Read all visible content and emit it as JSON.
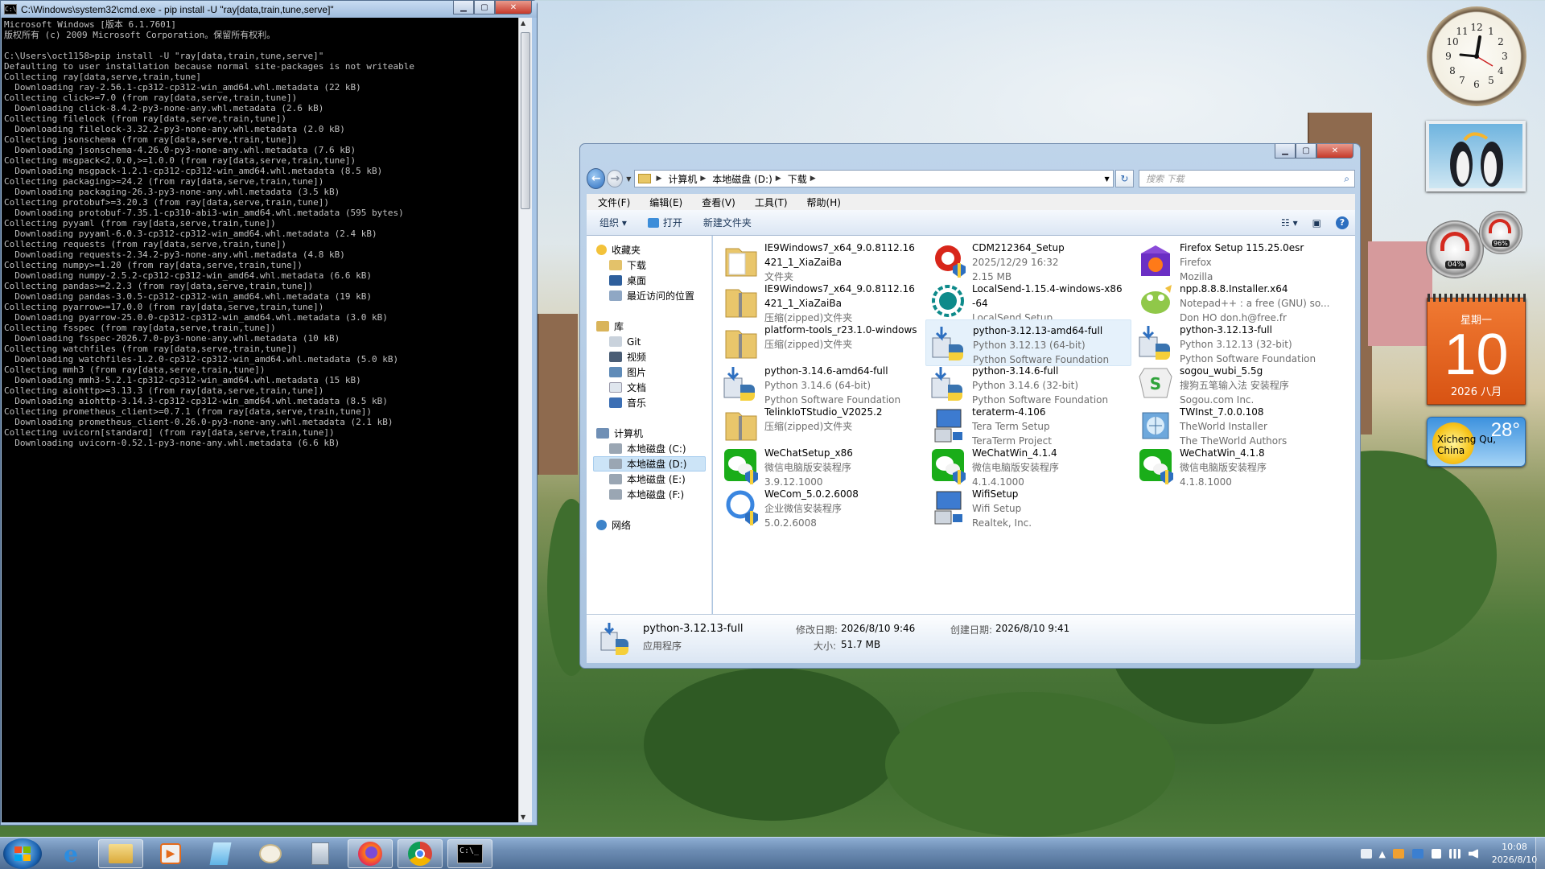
{
  "cmd": {
    "title": "C:\\Windows\\system32\\cmd.exe - pip  install -U \"ray[data,train,tune,serve]\"",
    "lines": [
      "Microsoft Windows [版本 6.1.7601]",
      "版权所有 (c) 2009 Microsoft Corporation。保留所有权利。",
      "",
      "C:\\Users\\oct1158>pip install -U \"ray[data,train,tune,serve]\"",
      "Defaulting to user installation because normal site-packages is not writeable",
      "Collecting ray[data,serve,train,tune]",
      "  Downloading ray-2.56.1-cp312-cp312-win_amd64.whl.metadata (22 kB)",
      "Collecting click>=7.0 (from ray[data,serve,train,tune])",
      "  Downloading click-8.4.2-py3-none-any.whl.metadata (2.6 kB)",
      "Collecting filelock (from ray[data,serve,train,tune])",
      "  Downloading filelock-3.32.2-py3-none-any.whl.metadata (2.0 kB)",
      "Collecting jsonschema (from ray[data,serve,train,tune])",
      "  Downloading jsonschema-4.26.0-py3-none-any.whl.metadata (7.6 kB)",
      "Collecting msgpack<2.0.0,>=1.0.0 (from ray[data,serve,train,tune])",
      "  Downloading msgpack-1.2.1-cp312-cp312-win_amd64.whl.metadata (8.5 kB)",
      "Collecting packaging>=24.2 (from ray[data,serve,train,tune])",
      "  Downloading packaging-26.3-py3-none-any.whl.metadata (3.5 kB)",
      "Collecting protobuf>=3.20.3 (from ray[data,serve,train,tune])",
      "  Downloading protobuf-7.35.1-cp310-abi3-win_amd64.whl.metadata (595 bytes)",
      "Collecting pyyaml (from ray[data,serve,train,tune])",
      "  Downloading pyyaml-6.0.3-cp312-cp312-win_amd64.whl.metadata (2.4 kB)",
      "Collecting requests (from ray[data,serve,train,tune])",
      "  Downloading requests-2.34.2-py3-none-any.whl.metadata (4.8 kB)",
      "Collecting numpy>=1.20 (from ray[data,serve,train,tune])",
      "  Downloading numpy-2.5.2-cp312-cp312-win_amd64.whl.metadata (6.6 kB)",
      "Collecting pandas>=2.2.3 (from ray[data,serve,train,tune])",
      "  Downloading pandas-3.0.5-cp312-cp312-win_amd64.whl.metadata (19 kB)",
      "Collecting pyarrow>=17.0.0 (from ray[data,serve,train,tune])",
      "  Downloading pyarrow-25.0.0-cp312-cp312-win_amd64.whl.metadata (3.0 kB)",
      "Collecting fsspec (from ray[data,serve,train,tune])",
      "  Downloading fsspec-2026.7.0-py3-none-any.whl.metadata (10 kB)",
      "Collecting watchfiles (from ray[data,serve,train,tune])",
      "  Downloading watchfiles-1.2.0-cp312-cp312-win_amd64.whl.metadata (5.0 kB)",
      "Collecting mmh3 (from ray[data,serve,train,tune])",
      "  Downloading mmh3-5.2.1-cp312-cp312-win_amd64.whl.metadata (15 kB)",
      "Collecting aiohttp>=3.13.3 (from ray[data,serve,train,tune])",
      "  Downloading aiohttp-3.14.3-cp312-cp312-win_amd64.whl.metadata (8.5 kB)",
      "Collecting prometheus_client>=0.7.1 (from ray[data,serve,train,tune])",
      "  Downloading prometheus_client-0.26.0-py3-none-any.whl.metadata (2.1 kB)",
      "Collecting uvicorn[standard] (from ray[data,serve,train,tune])",
      "  Downloading uvicorn-0.52.1-py3-none-any.whl.metadata (6.6 kB)"
    ]
  },
  "explorer": {
    "breadcrumb": [
      "计算机",
      "本地磁盘 (D:)",
      "下载"
    ],
    "search_placeholder": "搜索 下载",
    "menu": [
      "文件(F)",
      "编辑(E)",
      "查看(V)",
      "工具(T)",
      "帮助(H)"
    ],
    "toolbar": {
      "organize": "组织 ▾",
      "open": "打开",
      "new_folder": "新建文件夹"
    },
    "nav": {
      "favorites": "收藏夹",
      "downloads": "下载",
      "desktop": "桌面",
      "recent": "最近访问的位置",
      "libraries": "库",
      "git": "Git",
      "videos": "视频",
      "pictures": "图片",
      "documents": "文档",
      "music": "音乐",
      "computer": "计算机",
      "drive_c": "本地磁盘 (C:)",
      "drive_d": "本地磁盘 (D:)",
      "drive_e": "本地磁盘 (E:)",
      "drive_f": "本地磁盘 (F:)",
      "network": "网络"
    },
    "files": [
      {
        "name": "IE9Windows7_x64_9.0.8112.16421_1_XiaZaiBa",
        "l2": "文件夹",
        "l3": "",
        "icon": "folder-icon"
      },
      {
        "name": "CDM212364_Setup",
        "l2": "2025/12/29 16:32",
        "l3": "2.15 MB",
        "icon": "setup-icon"
      },
      {
        "name": "Firefox Setup 115.25.0esr",
        "l2": "Firefox",
        "l3": "Mozilla",
        "icon": "firefox-setup-icon"
      },
      {
        "name": "IE9Windows7_x64_9.0.8112.16421_1_XiaZaiBa",
        "l2": "压缩(zipped)文件夹",
        "l3": "",
        "icon": "zip-folder-icon"
      },
      {
        "name": "LocalSend-1.15.4-windows-x86-64",
        "l2": "LocalSend Setup",
        "l3": "",
        "icon": "localsend-icon"
      },
      {
        "name": "npp.8.8.8.Installer.x64",
        "l2": "Notepad++ : a free (GNU) so...",
        "l3": "Don HO don.h@free.fr",
        "icon": "notepadpp-icon"
      },
      {
        "name": "platform-tools_r23.1.0-windows",
        "l2": "压缩(zipped)文件夹",
        "l3": "",
        "icon": "zip-folder-icon"
      },
      {
        "name": "python-3.12.13-amd64-full",
        "l2": "Python 3.12.13 (64-bit)",
        "l3": "Python Software Foundation",
        "icon": "python-installer-icon"
      },
      {
        "name": "python-3.12.13-full",
        "l2": "Python 3.12.13 (32-bit)",
        "l3": "Python Software Foundation",
        "icon": "python-installer-icon"
      },
      {
        "name": "python-3.14.6-amd64-full",
        "l2": "Python 3.14.6 (64-bit)",
        "l3": "Python Software Foundation",
        "icon": "python-installer-icon"
      },
      {
        "name": "python-3.14.6-full",
        "l2": "Python 3.14.6 (32-bit)",
        "l3": "Python Software Foundation",
        "icon": "python-installer-icon"
      },
      {
        "name": "sogou_wubi_5.5g",
        "l2": "搜狗五笔输入法 安装程序",
        "l3": "Sogou.com Inc.",
        "icon": "sogou-icon"
      },
      {
        "name": "TelinkIoTStudio_V2025.2",
        "l2": "压缩(zipped)文件夹",
        "l3": "",
        "icon": "zip-folder-icon"
      },
      {
        "name": "teraterm-4.106",
        "l2": "Tera Term Setup",
        "l3": "TeraTerm Project",
        "icon": "setup-monitor-icon"
      },
      {
        "name": "TWInst_7.0.0.108",
        "l2": "TheWorld Installer",
        "l3": "The TheWorld Authors",
        "icon": "theworld-icon"
      },
      {
        "name": "WeChatSetup_x86",
        "l2": "微信电脑版安装程序",
        "l3": "3.9.12.1000",
        "icon": "wechat-icon"
      },
      {
        "name": "WeChatWin_4.1.4",
        "l2": "微信电脑版安装程序",
        "l3": "4.1.4.1000",
        "icon": "wechat-icon"
      },
      {
        "name": "WeChatWin_4.1.8",
        "l2": "微信电脑版安装程序",
        "l3": "4.1.8.1000",
        "icon": "wechat-icon"
      },
      {
        "name": "WeCom_5.0.2.6008",
        "l2": "企业微信安装程序",
        "l3": "5.0.2.6008",
        "icon": "wecom-icon"
      },
      {
        "name": "WifiSetup",
        "l2": "Wifi Setup",
        "l3": "Realtek, Inc.",
        "icon": "setup-monitor-icon"
      }
    ],
    "details": {
      "name": "python-3.12.13-full",
      "type": "应用程序",
      "modified_label": "修改日期:",
      "modified": "2026/8/10 9:46",
      "created_label": "创建日期:",
      "created": "2026/8/10 9:41",
      "size_label": "大小:",
      "size": "51.7 MB"
    }
  },
  "gadgets": {
    "cpu_label": "04%",
    "mem_label": "96%",
    "calendar": {
      "dow": "星期一",
      "day": "10",
      "ym": "2026 八月"
    },
    "weather": {
      "temp": "28°",
      "location": "Xicheng Qu, China"
    }
  },
  "taskbar": {
    "time": "10:08",
    "date": "2026/8/10"
  }
}
